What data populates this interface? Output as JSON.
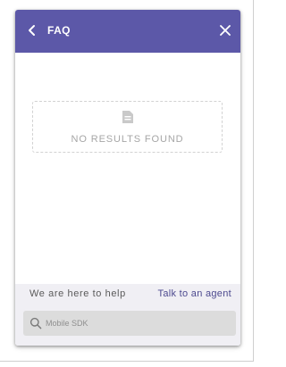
{
  "header": {
    "title": "FAQ",
    "back_icon": "chevron-left-icon",
    "close_icon": "close-icon",
    "background_color": "#5c58a8"
  },
  "empty_state": {
    "icon": "document-icon",
    "message": "NO RESULTS FOUND"
  },
  "help_bar": {
    "text": "We are here to help",
    "agent_link": "Talk to an agent",
    "link_color": "#4d4a8f"
  },
  "search": {
    "icon": "search-icon",
    "value": "",
    "placeholder": "Mobile SDK"
  }
}
